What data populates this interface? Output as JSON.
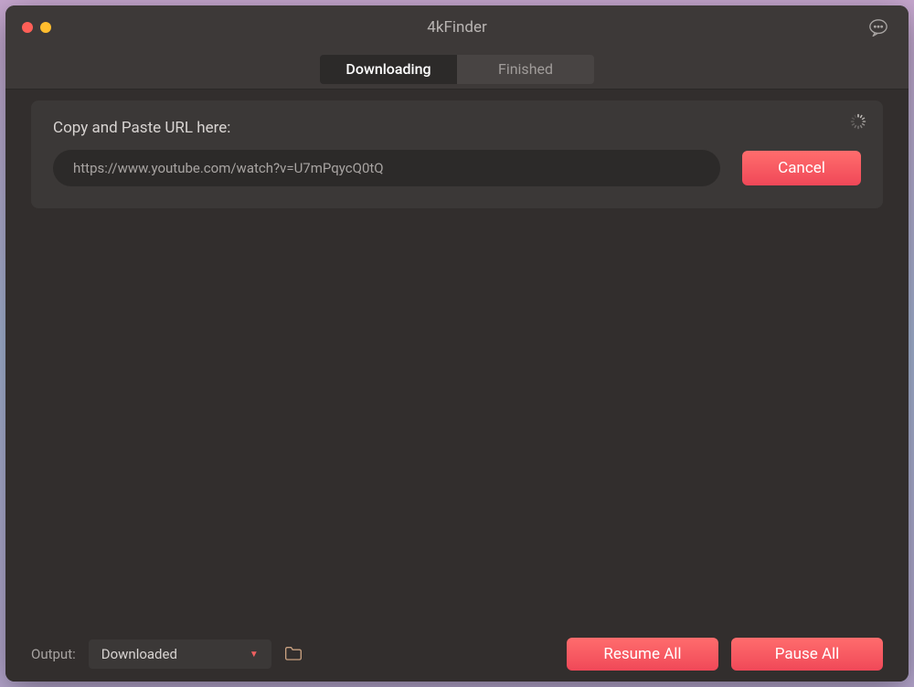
{
  "app": {
    "title": "4kFinder"
  },
  "tabs": {
    "downloading": "Downloading",
    "finished": "Finished"
  },
  "urlPanel": {
    "label": "Copy and Paste URL here:",
    "value": "https://www.youtube.com/watch?v=U7mPqycQ0tQ",
    "cancel": "Cancel"
  },
  "footer": {
    "outputLabel": "Output:",
    "outputValue": "Downloaded",
    "resumeAll": "Resume All",
    "pauseAll": "Pause All"
  }
}
